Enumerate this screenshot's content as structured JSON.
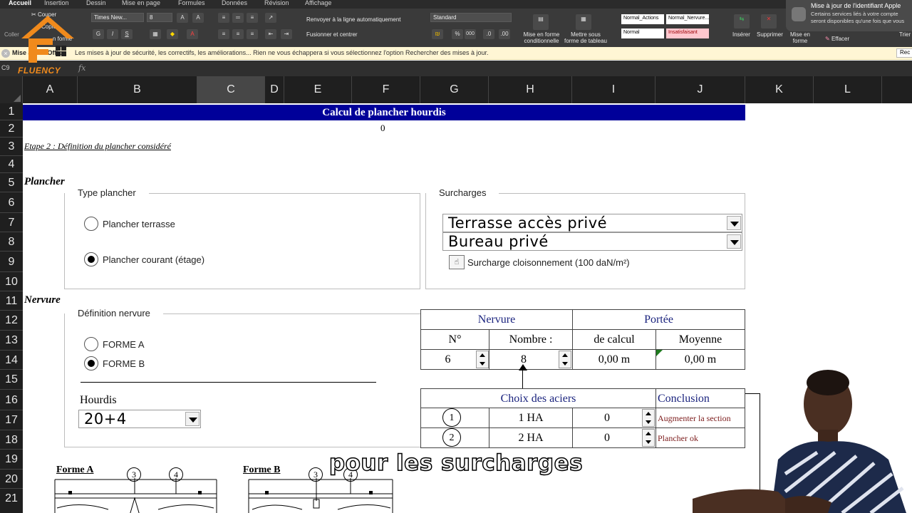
{
  "ribbon": {
    "tabs": [
      "Accueil",
      "Insertion",
      "Dessin",
      "Mise en page",
      "Formules",
      "Données",
      "Révision",
      "Affichage"
    ],
    "clipboard": {
      "paste": "Coller",
      "cut": "Couper",
      "copy": "Copier",
      "format": "n forme"
    },
    "font_name": "Times New...",
    "font_size": "8",
    "bold": "G",
    "italic": "I",
    "underline": "S",
    "wrap_text": "Renvoyer à la ligne automatiquement",
    "merge_center": "Fusionner et centrer",
    "number_format": "Standard",
    "conditional_format": "Mise en forme conditionnelle",
    "table_format": "Mettre sous forme de tableau",
    "styles": [
      "Normal_Actions",
      "Normal_Nervure...",
      "Normal",
      "Insatisfaisant"
    ],
    "insert": "Insérer",
    "delete": "Supprimer",
    "format": "Mise en forme",
    "clear": "Effacer",
    "filter": "Trier et filtrer"
  },
  "notification": {
    "title": "Mise à jour de l'identifiant Apple",
    "body": "Certains services liés à votre compte seront disponibles qu'une fois que vous"
  },
  "message_bar": {
    "label": "Mise à jour Office",
    "text": "Les mises à jour de sécurité, les correctifs, les améliorations... Rien ne vous échappera si vous sélectionnez l'option Rechercher des mises à jour.",
    "button": "Rec"
  },
  "formula_bar": {
    "cell_ref": "C9",
    "fx": "fx"
  },
  "columns": [
    "A",
    "B",
    "C",
    "D",
    "E",
    "F",
    "G",
    "H",
    "I",
    "J",
    "K",
    "L"
  ],
  "rows": [
    "1",
    "2",
    "3",
    "4",
    "5",
    "6",
    "7",
    "8",
    "9",
    "10",
    "11",
    "12",
    "13",
    "14",
    "15",
    "16",
    "17",
    "18",
    "19",
    "20",
    "21"
  ],
  "sheet": {
    "title": "Calcul de plancher hourdis",
    "row2_value": "0",
    "etape": "Etape 2 : Définition du plancher considéré",
    "plancher_header": "Plancher",
    "type_plancher": {
      "title": "Type plancher",
      "options": [
        "Plancher terrasse",
        "Plancher courant (étage)"
      ],
      "selected": 1
    },
    "surcharges": {
      "title": "Surcharges",
      "combo1": "Terrasse accès privé",
      "combo2": "Bureau privé",
      "checkbox_label": "Surcharge cloisonnement (100 daN/m²)"
    },
    "nervure_header": "Nervure",
    "definition_nervure": {
      "title": "Définition nervure",
      "options": [
        "FORME A",
        "FORME B"
      ],
      "selected": 1
    },
    "hourdis": {
      "label": "Hourdis",
      "value": "20+4"
    },
    "table_nervure": {
      "nervure": "Nervure",
      "portee": "Portée",
      "n": "N°",
      "nombre": "Nombre :",
      "de_calcul": "de calcul",
      "moyenne": "Moyenne",
      "n_value": "6",
      "nombre_value": "8",
      "calcul_value": "0,00 m",
      "moyenne_value": "0,00 m"
    },
    "table_aciers": {
      "choix": "Choix des aciers",
      "conclusion": "Conclusion",
      "rows": [
        {
          "num": "1",
          "acier": "1 HA",
          "value": "0",
          "conclusion": "Augmenter la section"
        },
        {
          "num": "2",
          "acier": "2 HA",
          "value": "0",
          "conclusion": "Plancher ok"
        }
      ]
    },
    "forme_a": {
      "label": "Forme A",
      "n1": "3",
      "n2": "4"
    },
    "forme_b": {
      "label": "Forme B",
      "n1": "3",
      "n2": "4"
    }
  },
  "subtitle": "pour les surcharges",
  "logo": {
    "text": "FLUENCY"
  }
}
